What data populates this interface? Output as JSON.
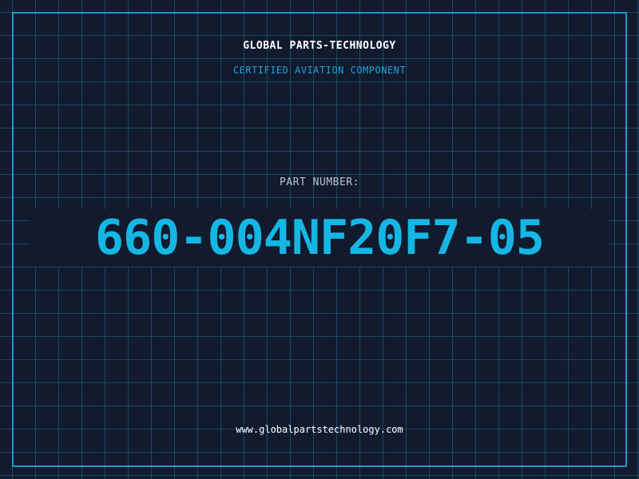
{
  "header": {
    "brand": "GLOBAL PARTS-TECHNOLOGY",
    "subtitle": "CERTIFIED AVIATION COMPONENT"
  },
  "part": {
    "label": "PART NUMBER:",
    "number": "660-004NF20F7-05"
  },
  "footer": {
    "website": "www.globalpartstechnology.com"
  },
  "colors": {
    "background": "#121a2e",
    "grid": "#226e8c",
    "accent": "#16b6e4",
    "border": "#1e9bc4"
  }
}
